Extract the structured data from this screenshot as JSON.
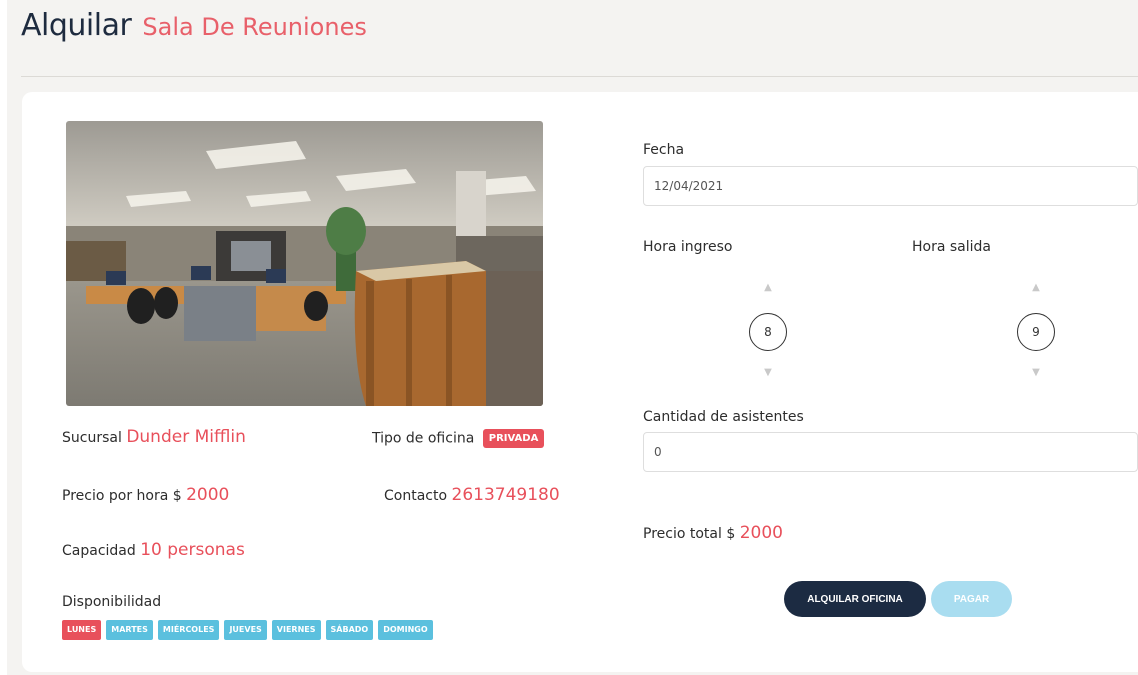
{
  "header": {
    "title": "Alquilar",
    "subtitle": "Sala De Reuniones"
  },
  "office": {
    "image_icon": "office-photo",
    "sucursal_label": "Sucursal",
    "sucursal_value": "Dunder Mifflin",
    "tipo_label": "Tipo de oficina",
    "tipo_value": "PRIVADA",
    "precio_label": "Precio por hora $",
    "precio_value": "2000",
    "contacto_label": "Contacto",
    "contacto_value": "2613749180",
    "capacidad_label": "Capacidad",
    "capacidad_value": "10 personas",
    "disponibilidad_label": "Disponibilidad",
    "days": [
      "LUNES",
      "MARTES",
      "MIÉRCOLES",
      "JUEVES",
      "VIERNES",
      "SÁBADO",
      "DOMINGO"
    ],
    "active_day": "LUNES"
  },
  "form": {
    "fecha_label": "Fecha",
    "fecha_value": "12/04/2021",
    "hora_ingreso_label": "Hora ingreso",
    "hora_ingreso_value": "8",
    "hora_salida_label": "Hora salida",
    "hora_salida_value": "9",
    "asistentes_label": "Cantidad de asistentes",
    "asistentes_value": "0",
    "precio_total_label": "Precio total $",
    "precio_total_value": "2000",
    "alquilar_button": "ALQUILAR OFICINA",
    "pagar_button": "PAGAR"
  },
  "colors": {
    "accent": "#e8505b",
    "primary": "#1c2b42",
    "info": "#5bc0de"
  }
}
